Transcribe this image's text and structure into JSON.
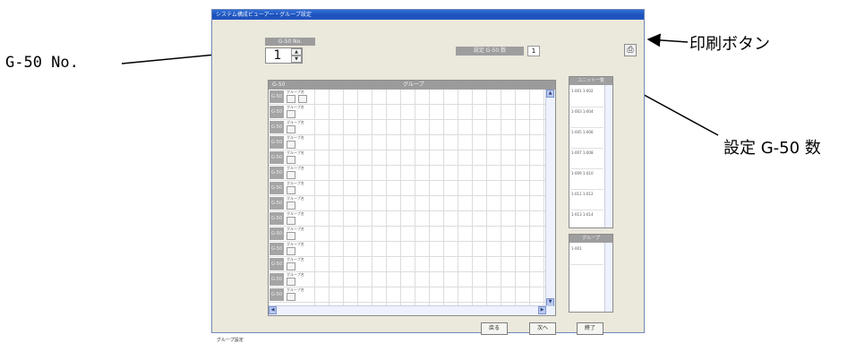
{
  "callouts": {
    "g50_no": "G-50 No.",
    "print_button": "印刷ボタン",
    "set_g50_count": "設定 G-50 数"
  },
  "window": {
    "title": "システム構成ビューアー・グループ設定"
  },
  "g50": {
    "label": "G-50 No.",
    "value": "1",
    "set_label": "設定 G-50 数",
    "set_value": "1"
  },
  "grid": {
    "header_left": "G-50",
    "header_right": "グループ",
    "rows": [
      {
        "label": "G-50",
        "name": "グループ名"
      },
      {
        "label": "G-50",
        "name": "グループ名"
      },
      {
        "label": "G-50",
        "name": "グループ名"
      },
      {
        "label": "G-50",
        "name": "グループ名"
      },
      {
        "label": "G-50",
        "name": "グループ名"
      },
      {
        "label": "G-50",
        "name": "グループ名"
      },
      {
        "label": "G-50",
        "name": "グループ名"
      },
      {
        "label": "G-50",
        "name": "グループ名"
      },
      {
        "label": "G-50",
        "name": "グループ名"
      },
      {
        "label": "G-50",
        "name": "グループ名"
      },
      {
        "label": "G-50",
        "name": "グループ名"
      },
      {
        "label": "G-50",
        "name": "グループ名"
      },
      {
        "label": "G-50",
        "name": "グループ名"
      },
      {
        "label": "G-50",
        "name": "グループ名"
      }
    ]
  },
  "side_panel_1": {
    "title": "ユニット一覧",
    "items": [
      "1-001  1-002",
      "1-003  1-004",
      "1-005  1-006",
      "1-007  1-008",
      "1-009  1-010",
      "1-011  1-012",
      "1-013  1-014"
    ]
  },
  "side_panel_2": {
    "title": "グループ",
    "items": [
      "1-001"
    ]
  },
  "buttons": {
    "back": "戻る",
    "next": "次へ",
    "exit": "終了"
  },
  "status": "グループ設定"
}
